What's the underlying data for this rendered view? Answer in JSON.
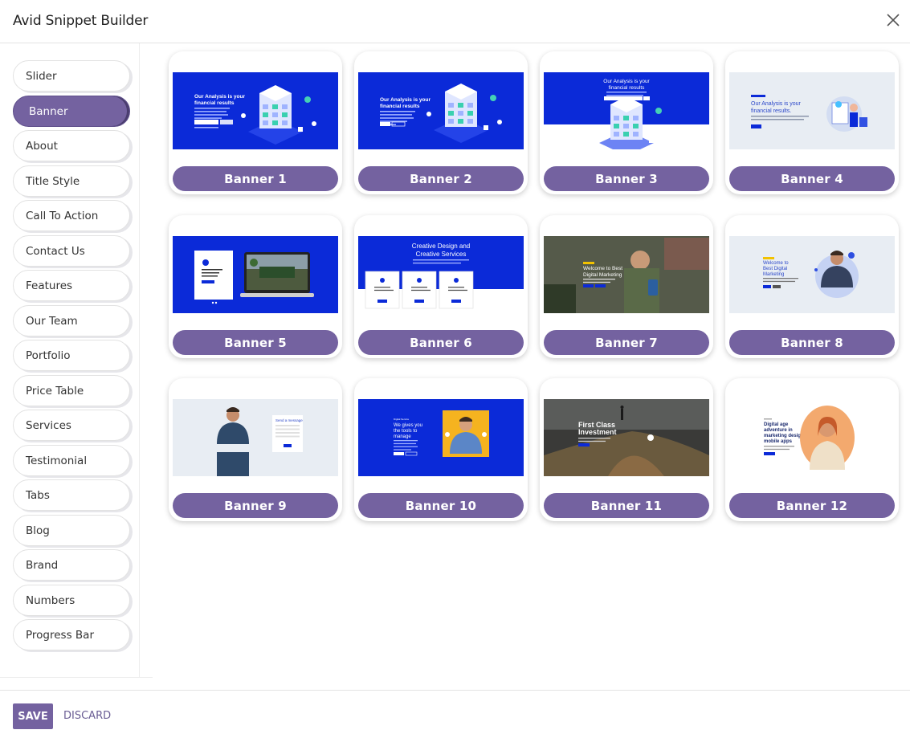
{
  "app": {
    "title": "Avid Snippet Builder",
    "close_icon": "close-icon"
  },
  "sidebar": {
    "items": [
      {
        "label": "Slider",
        "active": false
      },
      {
        "label": "Banner",
        "active": true
      },
      {
        "label": "About",
        "active": false
      },
      {
        "label": "Title Style",
        "active": false
      },
      {
        "label": "Call To Action",
        "active": false
      },
      {
        "label": "Contact Us",
        "active": false
      },
      {
        "label": "Features",
        "active": false
      },
      {
        "label": "Our Team",
        "active": false
      },
      {
        "label": "Portfolio",
        "active": false
      },
      {
        "label": "Price Table",
        "active": false
      },
      {
        "label": "Services",
        "active": false
      },
      {
        "label": "Testimonial",
        "active": false
      },
      {
        "label": "Tabs",
        "active": false
      },
      {
        "label": "Blog",
        "active": false
      },
      {
        "label": "Brand",
        "active": false
      },
      {
        "label": "Numbers",
        "active": false
      },
      {
        "label": "Progress Bar",
        "active": false
      }
    ]
  },
  "cards": [
    {
      "label": "Banner 1",
      "thumb_text": "Our Analysis is your financial results"
    },
    {
      "label": "Banner 2",
      "thumb_text": "Our Analysis is your financial results"
    },
    {
      "label": "Banner 3",
      "thumb_text": "Our Analysis is your financial results"
    },
    {
      "label": "Banner 4",
      "thumb_text": "Our Analysis is your financial results."
    },
    {
      "label": "Banner 5",
      "thumb_text": ""
    },
    {
      "label": "Banner 6",
      "thumb_text": "Creative Design and Creative Services"
    },
    {
      "label": "Banner 7",
      "thumb_text": "Welcome to Best Digital Marketing"
    },
    {
      "label": "Banner 8",
      "thumb_text": "Welcome to Best Digital Marketing"
    },
    {
      "label": "Banner 9",
      "thumb_text": "Send a message"
    },
    {
      "label": "Banner 10",
      "thumb_text": "We gives you the tools to manage"
    },
    {
      "label": "Banner 11",
      "thumb_text": "First Class Investment"
    },
    {
      "label": "Banner 12",
      "thumb_text": "Digital age adventure in marketing design mobile apps"
    }
  ],
  "footer": {
    "save_label": "SAVE",
    "discard_label": "DISCARD"
  },
  "colors": {
    "accent": "#7462a0",
    "thumb_blue": "#0b2ad8",
    "thumb_light": "#e8edf3"
  }
}
